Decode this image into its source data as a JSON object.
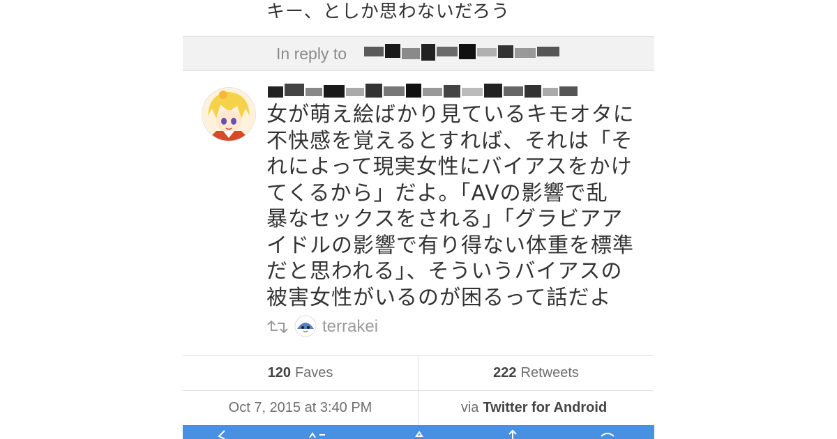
{
  "previous_tweet": {
    "text_tail": "キー、としか思わないだろう"
  },
  "reply_bar": {
    "label": "In reply to"
  },
  "tweet": {
    "text_lines": [
      "女が萌え絵ばかり見ているキモオタに",
      "不快感を覚えるとすれば、それは「そ",
      "れによって現実女性にバイアスをかけ",
      "てくるから」だよ。「AVの影響で乱",
      "暴なセックスをされる」「グラビアア",
      "イドルの影響で有り得ない体重を標準",
      "だと思われる」、そういうバイアスの",
      "被害女性がいるのが困るって話だよ"
    ],
    "retweeted_by": "terrakei"
  },
  "stats": {
    "faves_count": "120",
    "faves_label": "Faves",
    "retweets_count": "222",
    "retweets_label": "Retweets",
    "timestamp": "Oct 7, 2015 at 3:40 PM",
    "via_prefix": "via",
    "client": "Twitter for Android"
  },
  "icons": {
    "retweet": "retweet-icon",
    "reply": "reply-icon",
    "share": "share-icon",
    "fave": "heart-icon"
  },
  "colors": {
    "toolbar": "#4a90e2",
    "reply_bar_bg": "#f2f2f2",
    "muted_text": "#8a8a8a"
  }
}
